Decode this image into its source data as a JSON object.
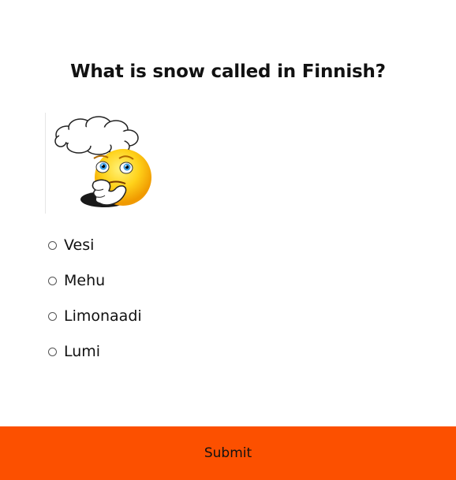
{
  "quiz": {
    "question": "What is snow called in Finnish?",
    "image": {
      "icon": "thinking-smiley-icon"
    },
    "options": [
      {
        "label": "Vesi",
        "selected": false
      },
      {
        "label": "Mehu",
        "selected": false
      },
      {
        "label": "Limonaadi",
        "selected": false
      },
      {
        "label": "Lumi",
        "selected": false
      }
    ],
    "submit_label": "Submit"
  },
  "colors": {
    "submit_bar": "#fc5000",
    "text": "#111111",
    "background": "#ffffff"
  }
}
